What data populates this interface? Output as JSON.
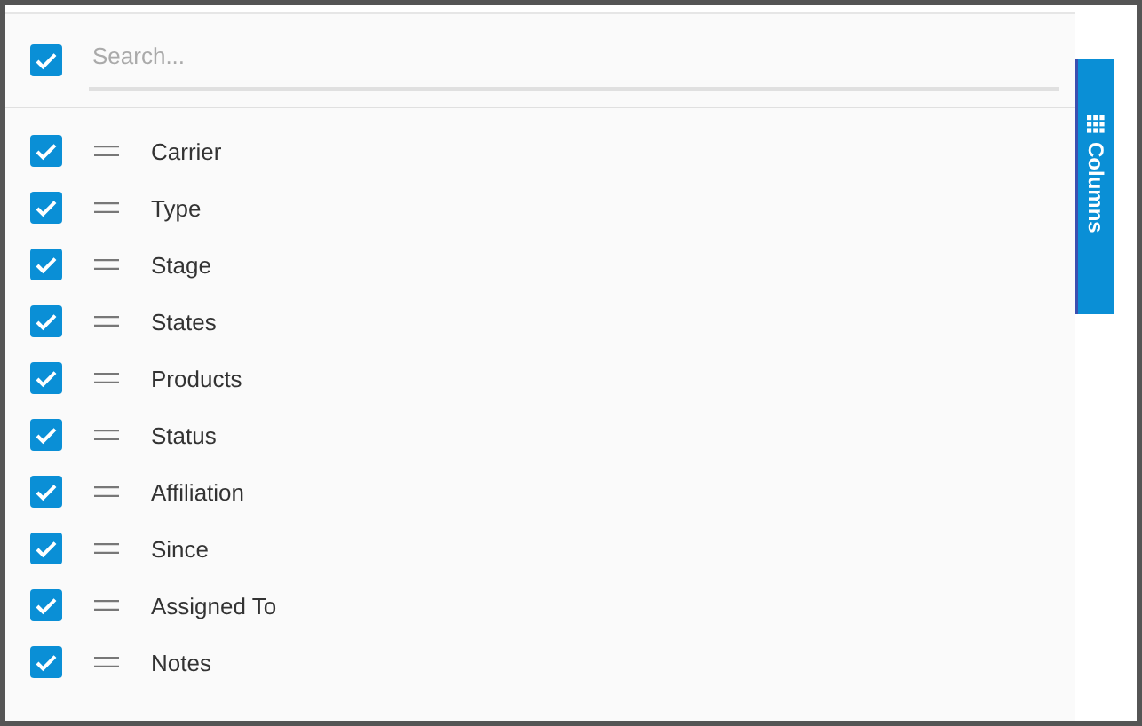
{
  "select_all": {
    "checked": true
  },
  "search": {
    "placeholder": "Search..."
  },
  "columns": [
    {
      "label": "Carrier",
      "checked": true
    },
    {
      "label": "Type",
      "checked": true
    },
    {
      "label": "Stage",
      "checked": true
    },
    {
      "label": "States",
      "checked": true
    },
    {
      "label": "Products",
      "checked": true
    },
    {
      "label": "Status",
      "checked": true
    },
    {
      "label": "Affiliation",
      "checked": true
    },
    {
      "label": "Since",
      "checked": true
    },
    {
      "label": "Assigned To",
      "checked": true
    },
    {
      "label": "Notes",
      "checked": true
    }
  ],
  "side_tab": {
    "label": "Columns",
    "selected": true
  }
}
